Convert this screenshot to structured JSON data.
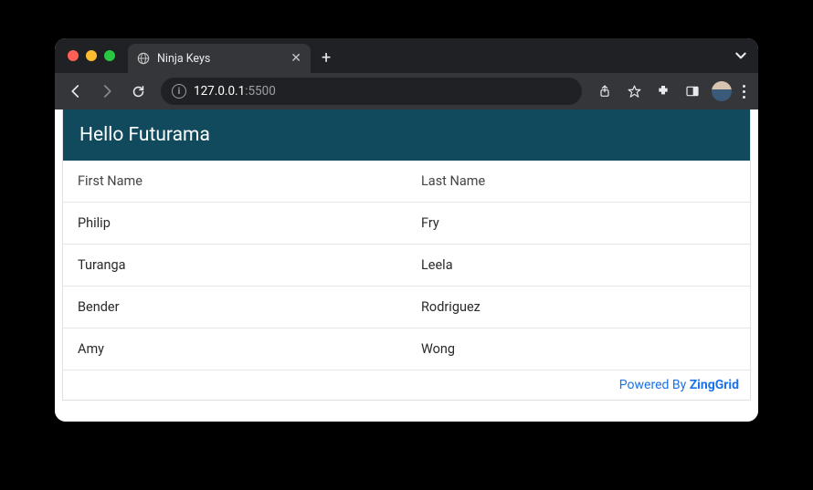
{
  "browser": {
    "tab_title": "Ninja Keys",
    "url_host": "127.0.0.1",
    "url_port": ":5500"
  },
  "grid": {
    "caption": "Hello Futurama",
    "columns": [
      "First Name",
      "Last Name"
    ],
    "rows": [
      {
        "first": "Philip",
        "last": "Fry"
      },
      {
        "first": "Turanga",
        "last": "Leela"
      },
      {
        "first": "Bender",
        "last": "Rodriguez"
      },
      {
        "first": "Amy",
        "last": "Wong"
      }
    ],
    "footer_prefix": "Powered By ",
    "footer_brand": "ZingGrid"
  }
}
